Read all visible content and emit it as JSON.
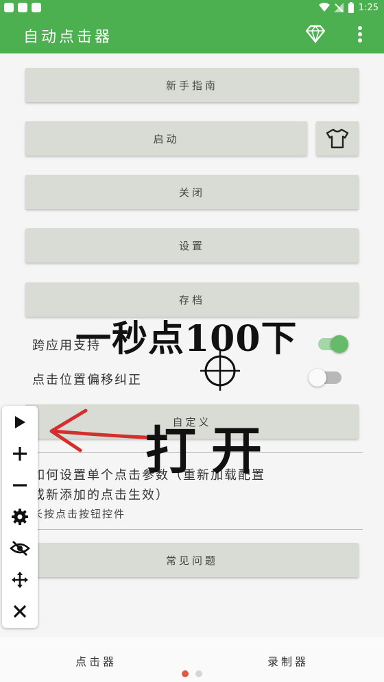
{
  "status": {
    "time": "1:25"
  },
  "app": {
    "title": "自动点击器",
    "icons": [
      "diamond-icon",
      "more-vert-icon"
    ]
  },
  "buttons": {
    "guide": "新手指南",
    "start": "启动",
    "close": "关闭",
    "settings": "设置",
    "archive": "存档",
    "hidden": "自定义"
  },
  "switches": {
    "cross_app": {
      "label": "跨应用支持",
      "on": true
    },
    "offset": {
      "label": "点击位置偏移纠正",
      "on": false
    }
  },
  "help": {
    "line1": "如何设置单个点击参数（重新加载配置",
    "line2": "或新添加的点击生效）",
    "line3": "长按点击按钮控件"
  },
  "faq": {
    "label": "常见问题"
  },
  "overlay": {
    "headline": "一秒点100下",
    "open": "打开"
  },
  "floating_toolbar": {
    "icons": [
      "play-icon",
      "plus-icon",
      "minus-icon",
      "gear-icon",
      "eye-off-icon",
      "move-icon",
      "close-icon"
    ]
  },
  "tabs": {
    "clicker": "点击器",
    "recorder": "录制器"
  },
  "colors": {
    "primary": "#4caf50",
    "accent_red": "#d32f2f"
  }
}
